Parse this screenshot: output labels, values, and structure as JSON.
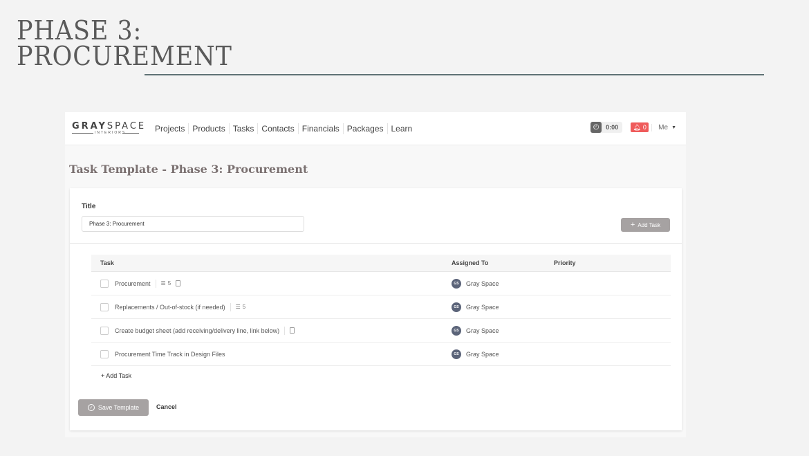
{
  "slide": {
    "title_lines": [
      "PHASE 3:",
      "PROCUREMENT"
    ],
    "accent_color": "#5f7275"
  },
  "nav": {
    "logo": {
      "word_bold": "GRAY",
      "word_light": "SPACE",
      "subtitle": "INTERIORS"
    },
    "menu": [
      "Projects",
      "Products",
      "Tasks",
      "Contacts",
      "Financials",
      "Packages",
      "Learn"
    ],
    "timer": {
      "icon": "stopwatch-icon",
      "value": "0:00"
    },
    "notifications": {
      "icon": "bell-icon",
      "count": "0",
      "color": "#ef5b5b"
    },
    "user": {
      "label": "Me",
      "icon": "caret-down-icon"
    }
  },
  "page": {
    "title": "Task Template - Phase 3: Procurement"
  },
  "form": {
    "title_label": "Title",
    "title_value": "Phase 3: Procurement",
    "add_task_button": "Add Task",
    "add_task_button_icon": "plus-icon",
    "table": {
      "headers": {
        "task": "Task",
        "assigned_to": "Assigned To",
        "priority": "Priority"
      },
      "rows": [
        {
          "task": "Procurement",
          "subtasks": "5",
          "has_subtasks": true,
          "has_file": true,
          "assignee_initials": "GS",
          "assignee": "Gray Space",
          "priority": ""
        },
        {
          "task": "Replacements / Out-of-stock (if needed)",
          "subtasks": "5",
          "has_subtasks": true,
          "has_file": false,
          "assignee_initials": "GS",
          "assignee": "Gray Space",
          "priority": ""
        },
        {
          "task": "Create budget sheet (add receiving/delivery line, link below)",
          "subtasks": "",
          "has_subtasks": false,
          "has_file": true,
          "assignee_initials": "GS",
          "assignee": "Gray Space",
          "priority": ""
        },
        {
          "task": "Procurement Time Track in Design Files",
          "subtasks": "",
          "has_subtasks": false,
          "has_file": false,
          "assignee_initials": "GS",
          "assignee": "Gray Space",
          "priority": ""
        }
      ]
    },
    "add_task_link": "+ Add Task",
    "save_button": "Save Template",
    "cancel_button": "Cancel"
  }
}
